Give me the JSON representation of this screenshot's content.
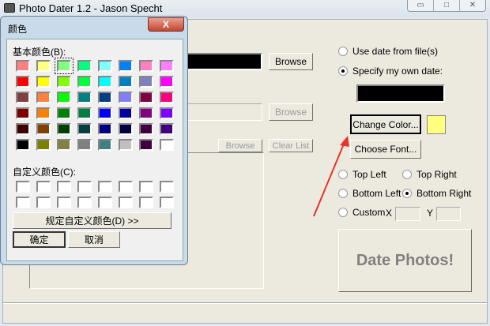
{
  "window": {
    "title": "Photo Dater 1.2 - Jason Specht",
    "controls": [
      "minimize",
      "maximize",
      "close"
    ]
  },
  "main": {
    "browse1": "Browse",
    "browse2": "Browse",
    "browse3": "Browse",
    "clear_list": "Clear List",
    "radio_use_file": "Use date from file(s)",
    "radio_specify": "Specify my own date:",
    "change_color": "Change Color...",
    "choose_font": "Choose Font...",
    "text_color": "#FFFF80",
    "pos_top_left": "Top Left",
    "pos_top_right": "Top Right",
    "pos_bottom_left": "Bottom Left",
    "pos_bottom_right": "Bottom Right",
    "pos_custom": "Custom",
    "x_label": "X",
    "y_label": "Y",
    "date_photos": "Date Photos!",
    "selected_source": "specify",
    "selected_position": "bottom-right"
  },
  "dialog": {
    "title": "颜色",
    "close": "X",
    "basic_label": "基本颜色(B):",
    "custom_label": "自定义颜色(C):",
    "define_custom": "规定自定义颜色(D) >>",
    "ok": "确定",
    "cancel": "取消",
    "selected_index": 2,
    "basic_colors": [
      "#FF8080",
      "#FFFF80",
      "#80FF80",
      "#00FF80",
      "#80FFFF",
      "#0080FF",
      "#FF80C0",
      "#FF80FF",
      "#FF0000",
      "#FFFF00",
      "#80FF00",
      "#00FF40",
      "#00FFFF",
      "#0080C0",
      "#8080C0",
      "#FF00FF",
      "#804040",
      "#FF8040",
      "#00FF00",
      "#008080",
      "#004080",
      "#8080FF",
      "#800040",
      "#FF0080",
      "#800000",
      "#FF8000",
      "#008000",
      "#008040",
      "#0000FF",
      "#0000A0",
      "#800080",
      "#8000FF",
      "#400000",
      "#804000",
      "#004000",
      "#004040",
      "#000080",
      "#000040",
      "#400040",
      "#400080",
      "#000000",
      "#808000",
      "#808040",
      "#808080",
      "#408080",
      "#C0C0C0",
      "#400040",
      "#FFFFFF"
    ],
    "custom_colors": [
      "#FFFFFF",
      "#FFFFFF",
      "#FFFFFF",
      "#FFFFFF",
      "#FFFFFF",
      "#FFFFFF",
      "#FFFFFF",
      "#FFFFFF",
      "#FFFFFF",
      "#FFFFFF",
      "#FFFFFF",
      "#FFFFFF",
      "#FFFFFF",
      "#FFFFFF",
      "#FFFFFF",
      "#FFFFFF"
    ]
  }
}
